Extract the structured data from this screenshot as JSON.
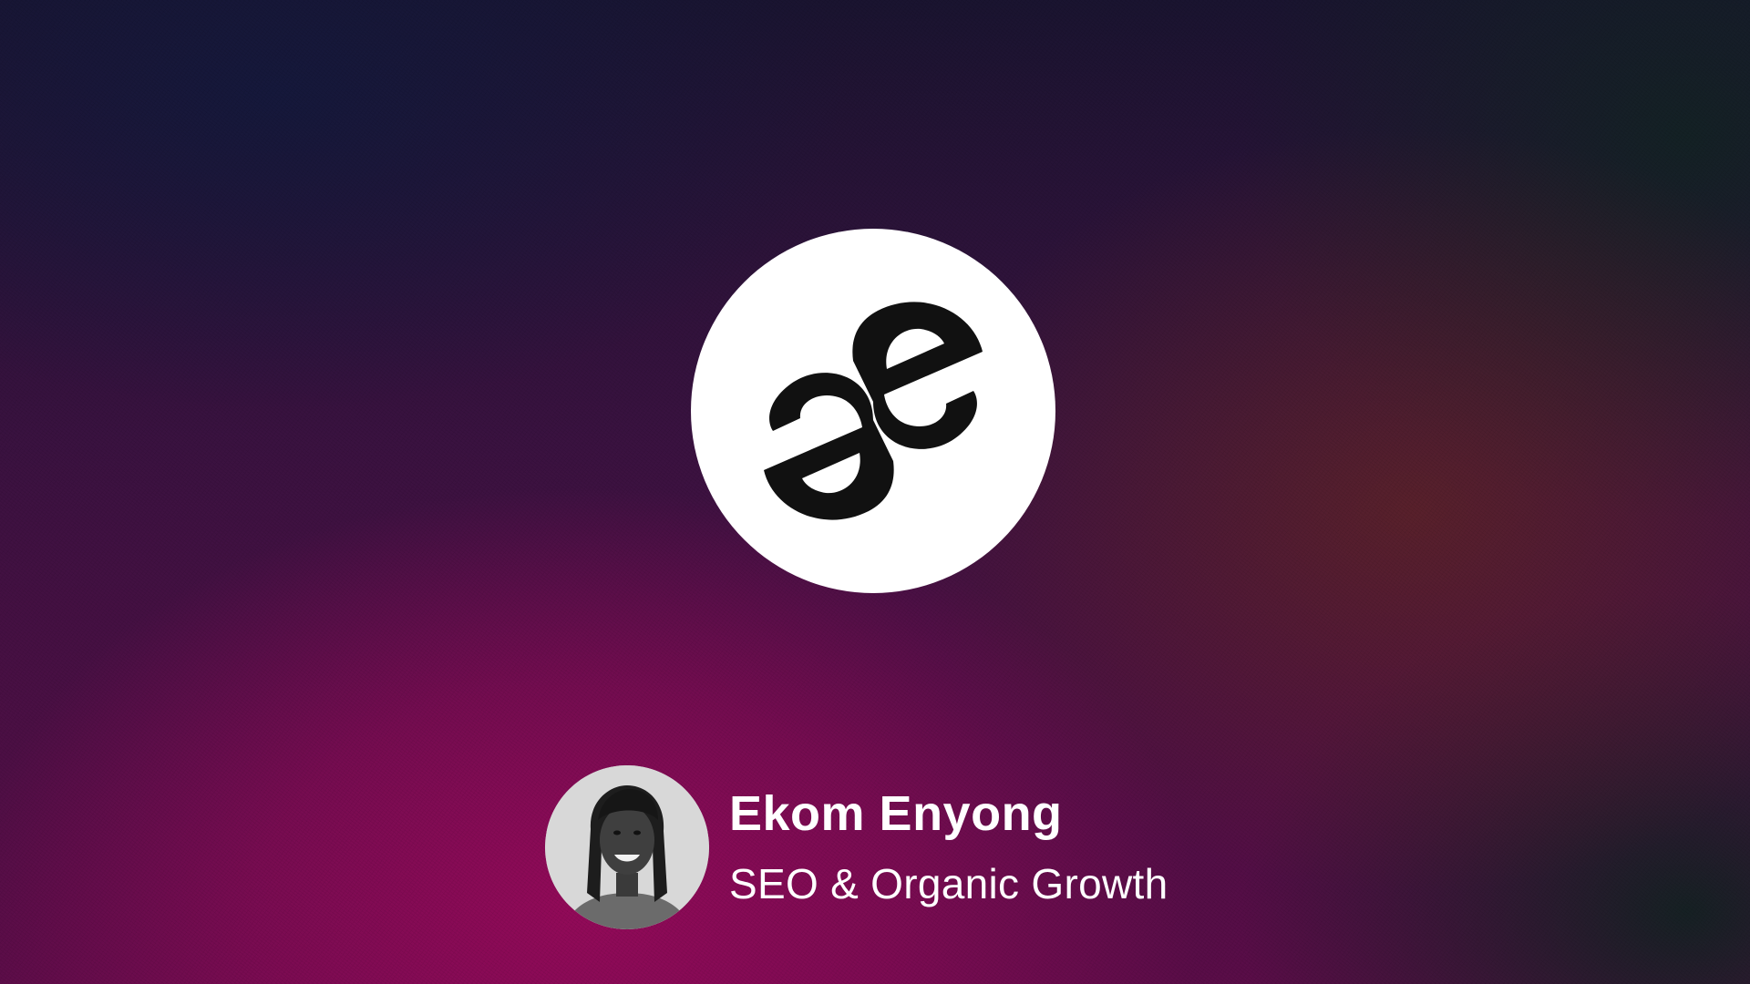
{
  "background": {
    "primary_color": "#8e0a58",
    "secondary_color": "#1a1430",
    "accent_color": "#6e2d19"
  },
  "logo": {
    "icon": "ae-ligature-logo-icon",
    "background_color": "#ffffff",
    "mark_color": "#111111"
  },
  "author": {
    "name": "Ekom Enyong",
    "role": "SEO & Organic Growth",
    "avatar_icon": "portrait-photo"
  }
}
